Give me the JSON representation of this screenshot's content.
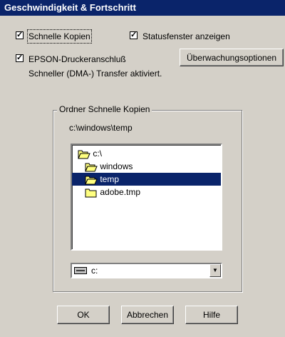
{
  "window": {
    "title": "Geschwindigkeit & Fortschritt"
  },
  "options": {
    "fast_copies": {
      "label": "Schnelle Kopien",
      "checked": true,
      "check_glyph": "✓"
    },
    "status_window": {
      "label": "Statusfenster anzeigen",
      "checked": true,
      "check_glyph": "✓"
    },
    "epson_port": {
      "label": "EPSON-Druckeranschluß",
      "checked": true,
      "check_glyph": "✓"
    },
    "monitoring_button": "Überwachungsoptionen",
    "dma_status": "Schneller (DMA-) Transfer aktiviert."
  },
  "folder_group": {
    "title": "Ordner Schnelle Kopien",
    "current_path": "c:\\windows\\temp",
    "tree": [
      {
        "label": "c:\\",
        "icon": "open-folder-icon",
        "selected": false
      },
      {
        "label": "windows",
        "icon": "open-folder-icon",
        "selected": false
      },
      {
        "label": "temp",
        "icon": "open-folder-icon",
        "selected": true
      },
      {
        "label": "adobe.tmp",
        "icon": "closed-folder-icon",
        "selected": false
      }
    ],
    "drive": {
      "value": "c:",
      "icon": "hard-drive-icon"
    }
  },
  "buttons": {
    "ok": "OK",
    "cancel": "Abbrechen",
    "help": "Hilfe"
  },
  "colors": {
    "face": "#d4d0c8",
    "selection": "#0a246a",
    "folder": "#ffff80"
  }
}
